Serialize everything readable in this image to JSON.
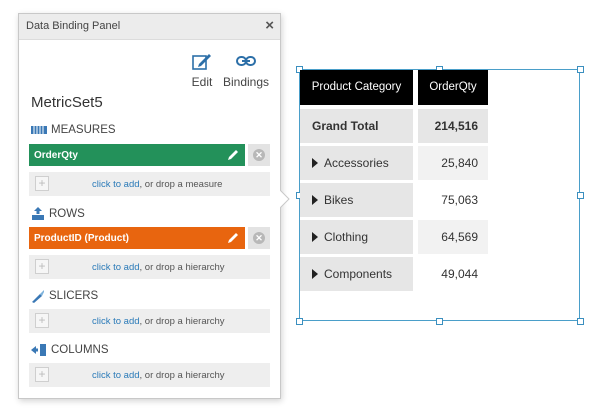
{
  "panel": {
    "title": "Data Binding Panel",
    "close_label": "×",
    "tools": {
      "edit_label": "Edit",
      "bindings_label": "Bindings"
    },
    "metric_set": "MetricSet5",
    "sections": {
      "measures": {
        "heading": "MEASURES",
        "chip": "OrderQty",
        "drop_link": "click to add",
        "drop_rest": ", or drop a measure"
      },
      "rows": {
        "heading": "ROWS",
        "chip": "ProductID (Product)",
        "drop_link": "click to add",
        "drop_rest": ", or drop a hierarchy"
      },
      "slicers": {
        "heading": "SLICERS",
        "drop_link": "click to add",
        "drop_rest": ", or drop a hierarchy"
      },
      "columns": {
        "heading": "COLUMNS",
        "drop_link": "click to add",
        "drop_rest": ", or drop a hierarchy"
      }
    }
  },
  "grid": {
    "headers": [
      "Product Category",
      "OrderQty"
    ],
    "grand_total": {
      "label": "Grand Total",
      "value": "214,516"
    },
    "rows": [
      {
        "label": "Accessories",
        "value": "25,840"
      },
      {
        "label": "Bikes",
        "value": "75,063"
      },
      {
        "label": "Clothing",
        "value": "64,569"
      },
      {
        "label": "Components",
        "value": "49,044"
      }
    ]
  },
  "colors": {
    "measure_chip": "#23915a",
    "row_chip": "#e8650f",
    "link": "#2a7ab8",
    "header_bg": "#000000",
    "selection": "#4a9ec9"
  },
  "icons": [
    "edit-icon",
    "bindings-icon",
    "close-icon",
    "measures-icon",
    "rows-icon",
    "slicers-icon",
    "columns-icon",
    "pencil-icon",
    "remove-icon",
    "add-icon",
    "expand-icon"
  ]
}
